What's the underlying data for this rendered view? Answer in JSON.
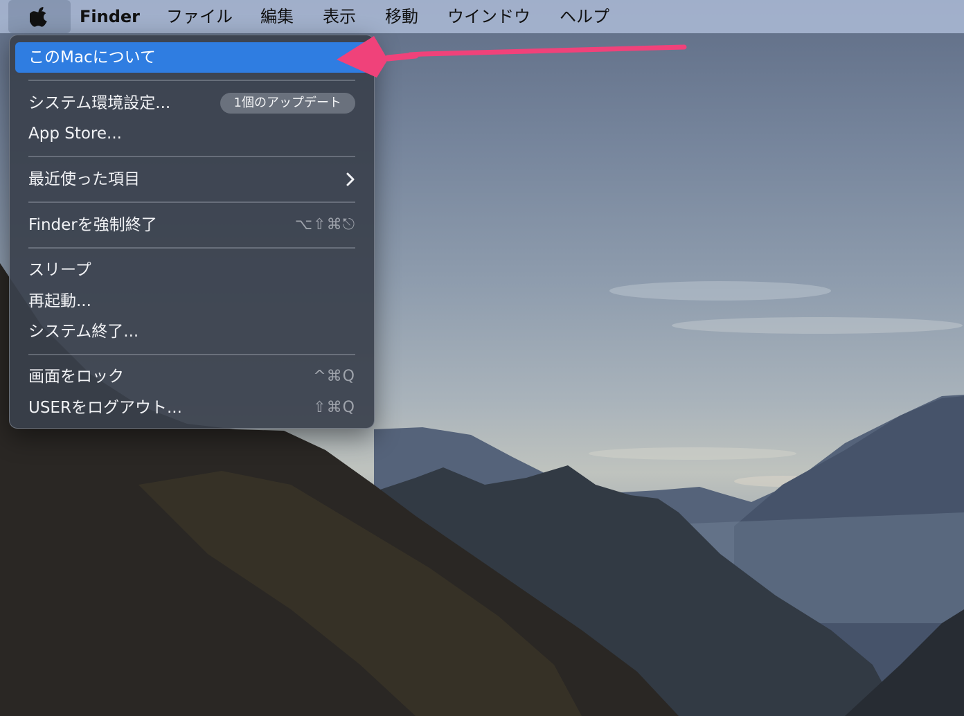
{
  "menubar": {
    "apple_icon": "apple-logo-icon",
    "app_name": "Finder",
    "items": [
      "ファイル",
      "編集",
      "表示",
      "移動",
      "ウインドウ",
      "ヘルプ"
    ]
  },
  "apple_menu": {
    "about": "このMacについて",
    "system_prefs": "システム環境設定...",
    "update_badge": "1個のアップデート",
    "app_store": "App Store...",
    "recent_items": "最近使った項目",
    "recent_items_icon": "chevron-right-icon",
    "force_quit": "Finderを強制終了",
    "force_quit_shortcut": "⌥⇧⌘⎋",
    "sleep": "スリープ",
    "restart": "再起動...",
    "shutdown": "システム終了...",
    "lock_screen": "画面をロック",
    "lock_screen_shortcut": "^⌘Q",
    "logout": "USERをログアウト...",
    "logout_shortcut": "⇧⌘Q"
  },
  "colors": {
    "highlight": "#2f7de1",
    "annotation_arrow": "#f0427a"
  }
}
